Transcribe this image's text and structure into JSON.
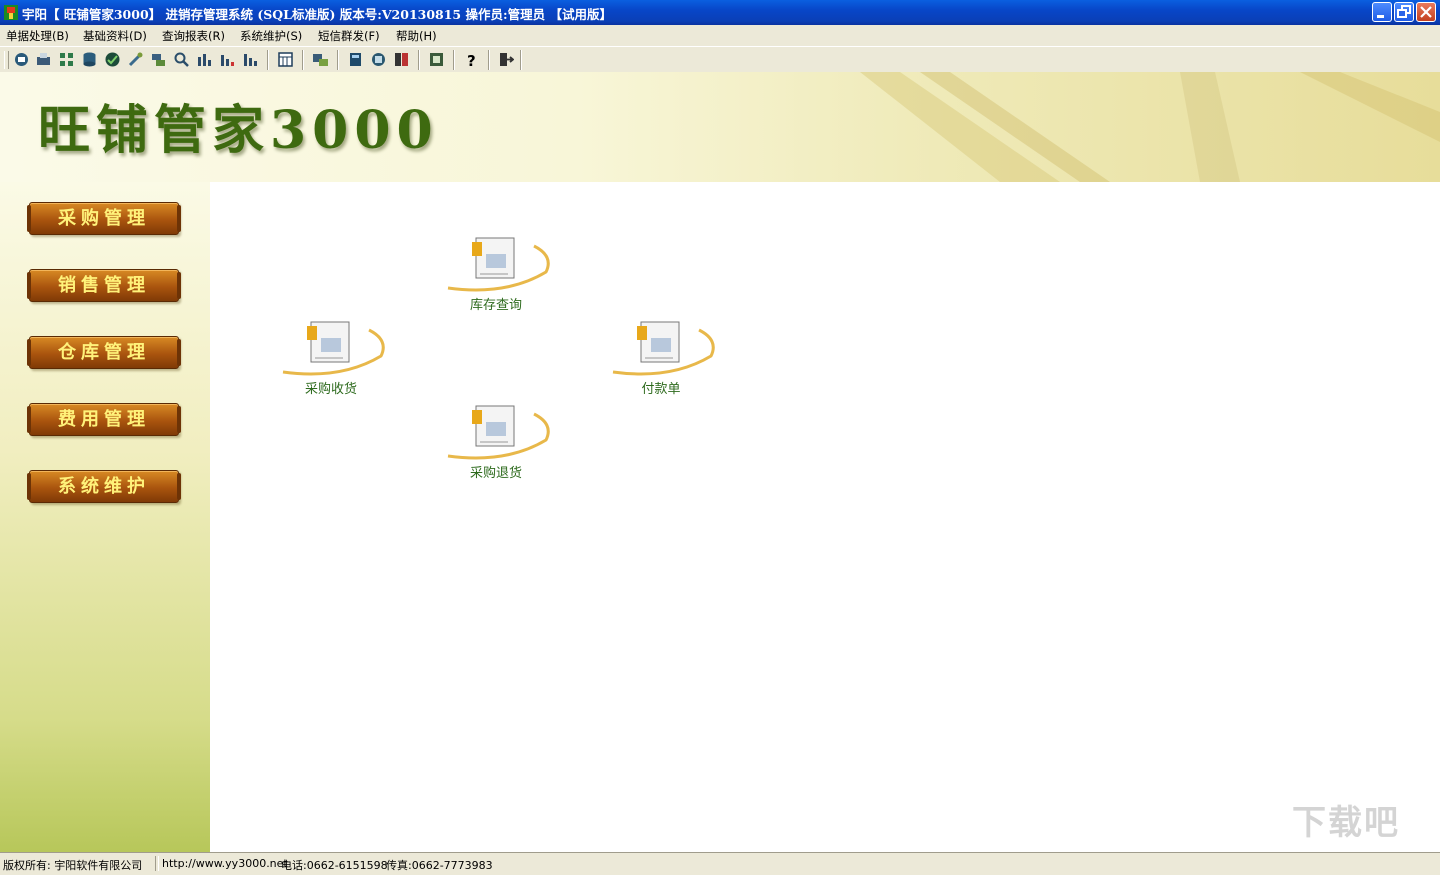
{
  "window": {
    "title": "宇阳【 旺铺管家3000】 进销存管理系统 (SQL标准版) 版本号:V20130815   操作员:管理员  【试用版】"
  },
  "menu": [
    {
      "label": "单据处理(B)"
    },
    {
      "label": "基础资料(D)"
    },
    {
      "label": "查询报表(R)"
    },
    {
      "label": "系统维护(S)"
    },
    {
      "label": "短信群发(F)"
    },
    {
      "label": "帮助(H)"
    }
  ],
  "toolbar_icons": [
    "mail-icon",
    "printer-icon",
    "grid-icon",
    "database-icon",
    "globe-icon",
    "tools-icon",
    "transfer-icon",
    "search-doc-icon",
    "bar-chart-icon",
    "bar-chart-2-icon",
    "bar-chart-3-icon",
    "calendar-icon",
    "exchange-icon",
    "calculator-icon",
    "network-icon",
    "report-icon",
    "archive-icon",
    "help-icon",
    "exit-icon"
  ],
  "banner": {
    "logo_text": "旺铺管家3000"
  },
  "sidebar": [
    {
      "label": "采购管理"
    },
    {
      "label": "销售管理"
    },
    {
      "label": "仓库管理"
    },
    {
      "label": "费用管理"
    },
    {
      "label": "系统维护"
    }
  ],
  "functions": [
    {
      "label": "库存查询"
    },
    {
      "label": "采购收货"
    },
    {
      "label": "付款单"
    },
    {
      "label": "采购退货"
    }
  ],
  "status": {
    "copyright": "版权所有: 宇阳软件有限公司",
    "url": "http://www.yy3000.net",
    "phone": "电话:0662-6151598",
    "fax": "传真:0662-7773983"
  },
  "watermark": "下载吧",
  "colors": {
    "title_bar": "#0846c8",
    "sidebar_button": "#a9540e",
    "sidebar_text": "#fff27a",
    "function_label": "#2e6b1e"
  }
}
